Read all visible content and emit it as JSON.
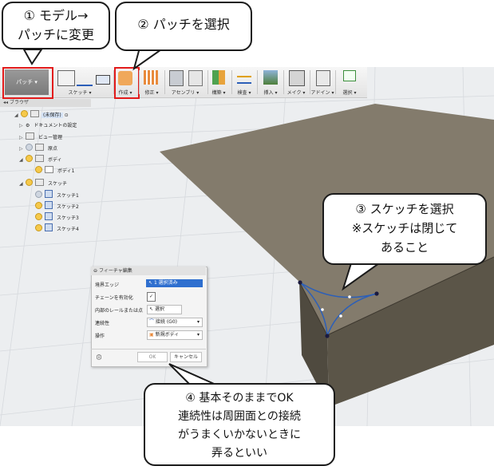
{
  "toolbar": {
    "workspace": "パッチ ▾",
    "groups": [
      {
        "label": "スケッチ ▾"
      },
      {
        "label": "作成 ▾"
      },
      {
        "label": "修正 ▾"
      },
      {
        "label": "アセンブリ ▾"
      },
      {
        "label": "構築 ▾"
      },
      {
        "label": "検査 ▾"
      },
      {
        "label": "挿入 ▾"
      },
      {
        "label": "メイク ▾"
      },
      {
        "label": "アドイン ▾"
      },
      {
        "label": "選択 ▾"
      }
    ]
  },
  "browser": {
    "title": "ブラウザ",
    "root": "(未保存)",
    "items": [
      {
        "label": "ドキュメントの設定"
      },
      {
        "label": "ビュー管理"
      },
      {
        "label": "原点"
      },
      {
        "label": "ボディ"
      },
      {
        "label": "ボディ1"
      },
      {
        "label": "スケッチ"
      },
      {
        "label": "スケッチ1"
      },
      {
        "label": "スケッチ2"
      },
      {
        "label": "スケッチ3"
      },
      {
        "label": "スケッチ4"
      }
    ]
  },
  "dialog": {
    "title": "フィーチャ編集",
    "rows": [
      {
        "label": "境界エッジ",
        "value": "1 選択済み"
      },
      {
        "label": "チェーンを有効化",
        "value": "✓"
      },
      {
        "label": "内部のレールまたは点",
        "value": "選択"
      },
      {
        "label": "連続性",
        "value": "接続 (G0)"
      },
      {
        "label": "操作",
        "value": "新規ボディ"
      }
    ],
    "ok": "OK",
    "cancel": "キャンセル"
  },
  "callouts": {
    "c1": {
      "line1": "① モデル→",
      "line2": "パッチに変更"
    },
    "c2": {
      "line1": "② パッチを選択"
    },
    "c3": {
      "line1": "③ スケッチを選択",
      "line2": "※スケッチは閉じて",
      "line3": "あること"
    },
    "c4": {
      "line1": "④ 基本そのままでOK",
      "line2": "連続性は周囲面との接続",
      "line3": "がうまくいかないときに",
      "line4": "弄るといい"
    }
  },
  "colors": {
    "box_top": "#837b6c",
    "box_front": "#595347",
    "box_side": "#4a453b",
    "highlight": "#e21b1b",
    "sketch": "#2c5fb8"
  }
}
